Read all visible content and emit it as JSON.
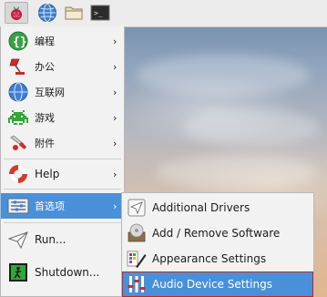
{
  "taskbar": {
    "buttons": [
      {
        "icon": "raspberry-icon"
      },
      {
        "icon": "globe-icon"
      },
      {
        "icon": "folder-icon"
      },
      {
        "icon": "terminal-icon",
        "text": ">_"
      }
    ]
  },
  "main_menu": {
    "items": [
      {
        "label": "编程",
        "icon": "programming-icon",
        "has_submenu": true
      },
      {
        "label": "办公",
        "icon": "office-lamp-icon",
        "has_submenu": true
      },
      {
        "label": "互联网",
        "icon": "internet-globe-icon",
        "has_submenu": true
      },
      {
        "label": "游戏",
        "icon": "games-invader-icon",
        "has_submenu": true
      },
      {
        "label": "附件",
        "icon": "accessories-knife-icon",
        "has_submenu": true
      },
      {
        "label": "Help",
        "icon": "help-lifebuoy-icon",
        "has_submenu": true
      },
      {
        "label": "首选项",
        "icon": "preferences-icon",
        "has_submenu": true,
        "selected": true
      },
      {
        "label": "Run...",
        "icon": "run-paperplane-icon",
        "has_submenu": false
      },
      {
        "label": "Shutdown...",
        "icon": "shutdown-exit-icon",
        "has_submenu": false
      }
    ],
    "arrow_glyph": "›"
  },
  "submenu": {
    "items": [
      {
        "label": "Additional Drivers",
        "icon": "drivers-icon"
      },
      {
        "label": "Add / Remove Software",
        "icon": "software-disc-icon"
      },
      {
        "label": "Appearance Settings",
        "icon": "appearance-icon"
      },
      {
        "label": "Audio Device Settings",
        "icon": "audio-mixer-icon",
        "selected": true
      }
    ]
  },
  "colors": {
    "selection": "#4a90d9",
    "highlight_outline": "#d21f1f",
    "menu_bg": "#f2f2f2"
  }
}
